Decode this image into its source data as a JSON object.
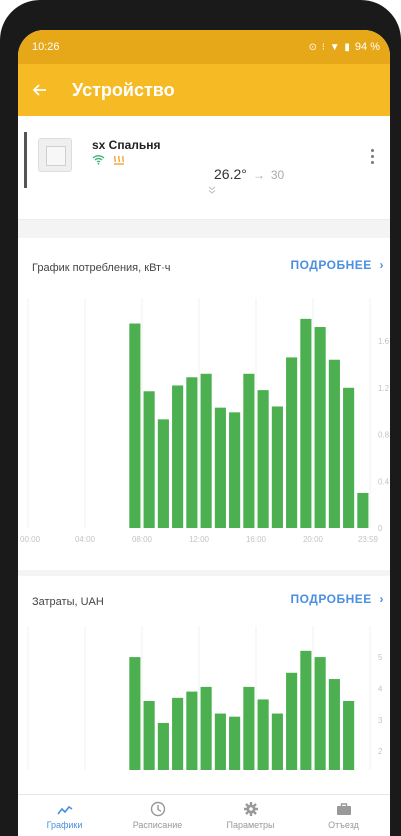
{
  "status_bar": {
    "time": "10:26",
    "battery": "94 %"
  },
  "app_bar": {
    "title": "Устройство"
  },
  "device": {
    "name": "sx Спальня",
    "current_temp": "26.2°",
    "arrow": "→",
    "target_temp": "30"
  },
  "consumption_card": {
    "title": "График потребления, кВт·ч",
    "link": "ПОДРОБНЕЕ",
    "chart_data": {
      "type": "bar",
      "x_tick_labels": [
        "00:00",
        "04:00",
        "08:00",
        "12:00",
        "16:00",
        "20:00",
        "23:59"
      ],
      "y_tick_labels": [
        "0",
        "0.4",
        "0.8",
        "1.2",
        "1.6"
      ],
      "ylim": [
        0,
        1.9
      ],
      "hours": [
        7,
        8,
        9,
        10,
        11,
        12,
        13,
        14,
        15,
        16,
        17,
        18,
        19,
        20,
        21,
        22,
        23
      ],
      "values": [
        1.75,
        1.17,
        0.93,
        1.22,
        1.29,
        1.32,
        1.03,
        0.99,
        1.32,
        1.18,
        1.04,
        1.46,
        1.79,
        1.72,
        1.44,
        1.2,
        0.3
      ],
      "color": "#4caf50",
      "grid": true
    }
  },
  "costs_card": {
    "title": "Затраты, UAH",
    "link": "ПОДРОБНЕЕ",
    "chart_data": {
      "type": "bar",
      "y_tick_labels": [
        "2",
        "3",
        "4",
        "5"
      ],
      "ylim": [
        1.4,
        5.8
      ],
      "hours": [
        7,
        8,
        9,
        10,
        11,
        12,
        13,
        14,
        15,
        16,
        17,
        18,
        19,
        20,
        21,
        22
      ],
      "values": [
        5.0,
        3.6,
        2.9,
        3.7,
        3.9,
        4.05,
        3.2,
        3.1,
        4.05,
        3.65,
        3.2,
        4.5,
        5.2,
        5.0,
        4.3,
        3.6
      ],
      "color": "#4caf50",
      "grid": true
    }
  },
  "bottom_nav": [
    {
      "label": "Графики",
      "icon": "chart-icon",
      "active": true
    },
    {
      "label": "Расписание",
      "icon": "clock-icon",
      "active": false
    },
    {
      "label": "Параметры",
      "icon": "gear-icon",
      "active": false
    },
    {
      "label": "Отъезд",
      "icon": "suitcase-icon",
      "active": false
    }
  ],
  "colors": {
    "accent": "#f6bb24",
    "status_bar": "#e6a818",
    "link": "#4a8fe0",
    "bar": "#4caf50"
  }
}
